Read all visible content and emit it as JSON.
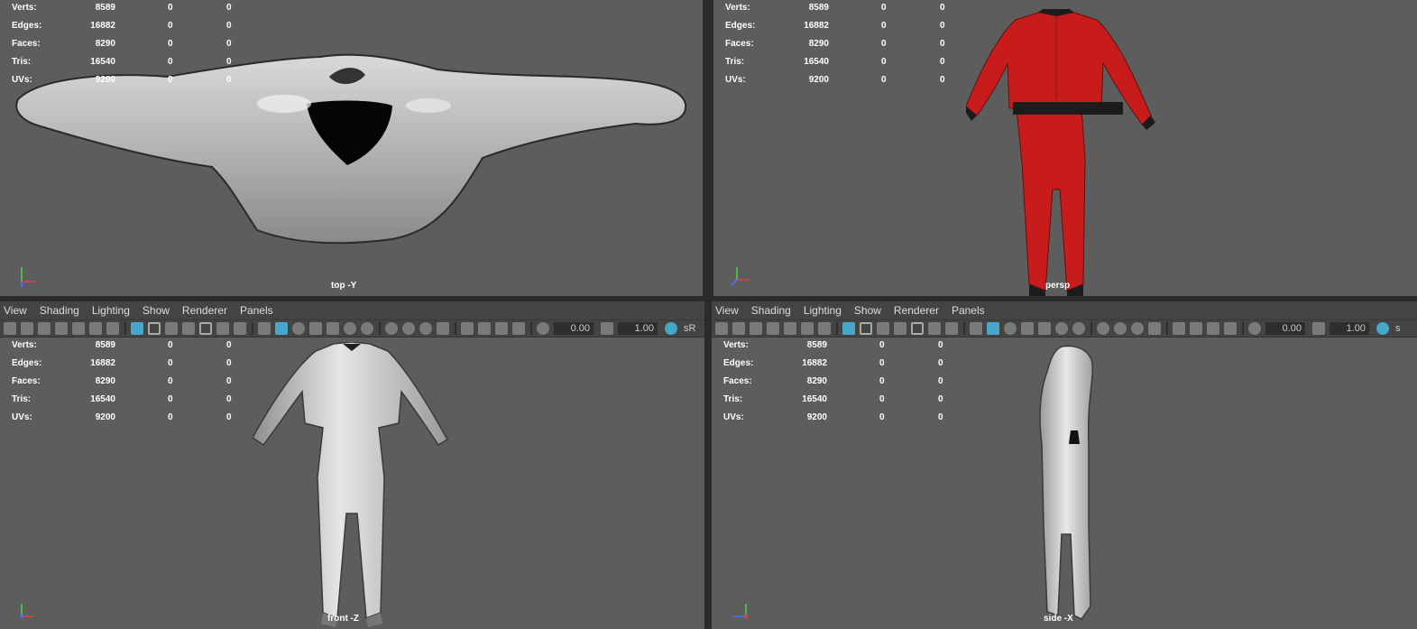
{
  "stats": [
    {
      "label": "Verts:",
      "v1": "8589",
      "v2": "0",
      "v3": "0"
    },
    {
      "label": "Edges:",
      "v1": "16882",
      "v2": "0",
      "v3": "0"
    },
    {
      "label": "Faces:",
      "v1": "8290",
      "v2": "0",
      "v3": "0"
    },
    {
      "label": "Tris:",
      "v1": "16540",
      "v2": "0",
      "v3": "0"
    },
    {
      "label": "UVs:",
      "v1": "9200",
      "v2": "0",
      "v3": "0"
    }
  ],
  "menu": [
    "View",
    "Shading",
    "Lighting",
    "Show",
    "Renderer",
    "Panels"
  ],
  "toolbar": {
    "field1": "0.00",
    "field2": "1.00",
    "srgb_front": "sR",
    "srgb_side": "s"
  },
  "cameras": {
    "top": "top -Y",
    "persp": "persp",
    "front": "front -Z",
    "side": "side -X"
  },
  "colors": {
    "viewport_bg": "#5d5d5d",
    "panel_bg": "#444444",
    "accent": "#46a7c9",
    "suit_red": "#c81c1c",
    "mesh_grey": "#bdbdbd"
  }
}
